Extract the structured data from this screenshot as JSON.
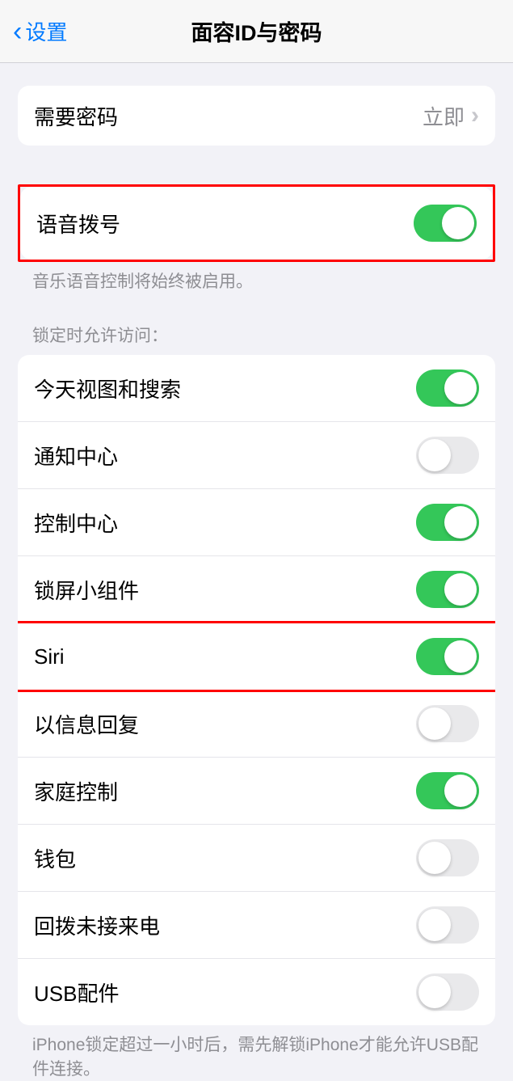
{
  "header": {
    "back_label": "设置",
    "title": "面容ID与密码"
  },
  "require_passcode": {
    "label": "需要密码",
    "value": "立即"
  },
  "voice_dial": {
    "label": "语音拨号",
    "on": true,
    "footer": "音乐语音控制将始终被启用。"
  },
  "allow_access_header": "锁定时允许访问：",
  "allow_access_items": [
    {
      "label": "今天视图和搜索",
      "on": true
    },
    {
      "label": "通知中心",
      "on": false
    },
    {
      "label": "控制中心",
      "on": true
    },
    {
      "label": "锁屏小组件",
      "on": true
    },
    {
      "label": "Siri",
      "on": true
    },
    {
      "label": "以信息回复",
      "on": false
    },
    {
      "label": "家庭控制",
      "on": true
    },
    {
      "label": "钱包",
      "on": false
    },
    {
      "label": "回拨未接来电",
      "on": false
    },
    {
      "label": "USB配件",
      "on": false
    }
  ],
  "usb_footer": "iPhone锁定超过一小时后，需先解锁iPhone才能允许USB配件连接。"
}
